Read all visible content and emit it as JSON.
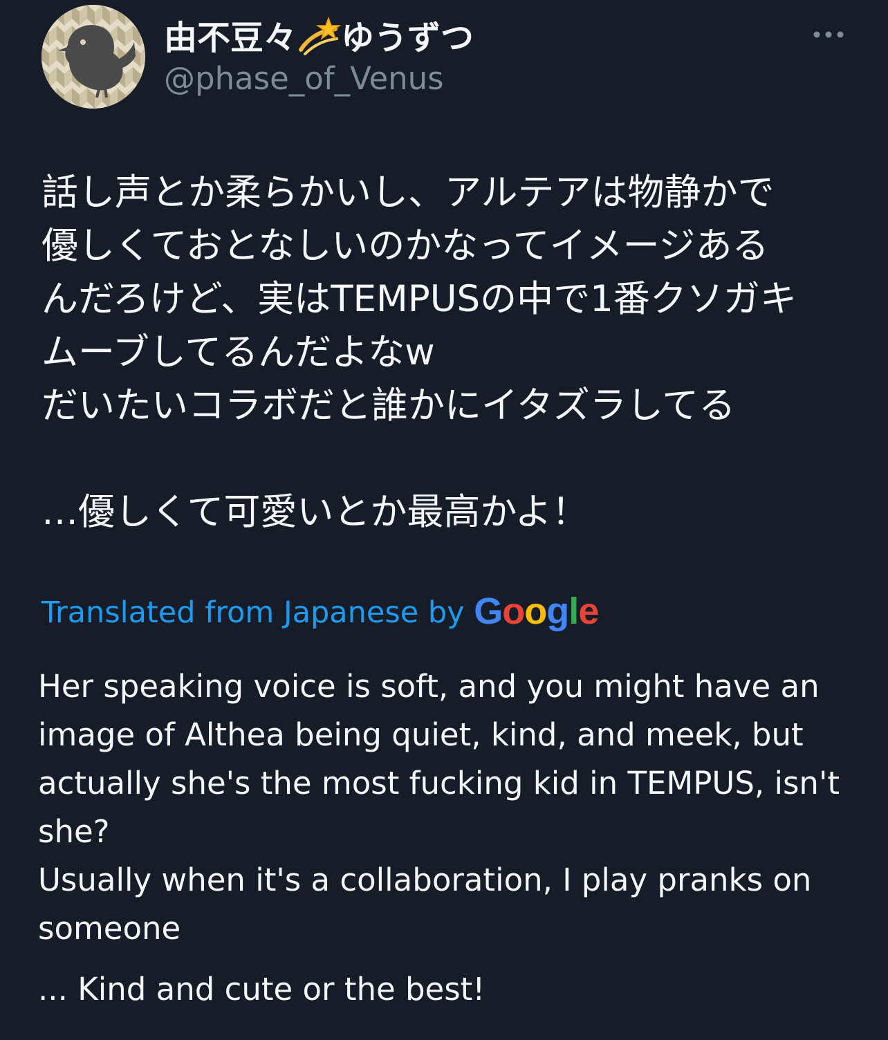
{
  "author": {
    "display_name": "由不豆々",
    "display_name_suffix": "ゆうずつ",
    "display_name_emoji": "dizzy-star-icon",
    "handle": "@phase_of_Venus",
    "avatar": "bird-silhouette-avatar"
  },
  "menu": {
    "more_icon": "more-options-icon"
  },
  "tweet": {
    "original_text": "話し声とか柔らかいし、アルテアは物静かで\n優しくておとなしいのかなってイメージある\nんだろけど、実はTEMPUSの中で1番クソガキ\nムーブしてるんだよなw\nだいたいコラボだと誰かにイタズラしてる\n\n…優しくて可愛いとか最高かよ！",
    "translation_label": "Translated from Japanese by",
    "translation_provider": "Google",
    "translated_paragraphs": [
      "Her speaking voice is soft, and you might have an image of Althea being quiet, kind, and meek, but actually she's the most fucking kid in TEMPUS, isn't she?",
      "Usually when it's a collaboration, I play pranks on someone",
      "... Kind and cute or the best!"
    ]
  },
  "colors": {
    "background": "#161d28",
    "text": "#f5f7fa",
    "secondary_text": "#7d8b99",
    "link": "#1d9bf0",
    "google_blue": "#4285f4",
    "google_red": "#ea4335",
    "google_yellow": "#fbbc05",
    "google_green": "#34a853"
  }
}
